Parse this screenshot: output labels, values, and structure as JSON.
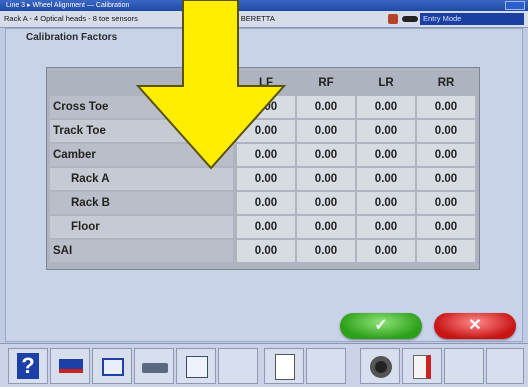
{
  "titlebar": {
    "title": "Line 3 ▸ Wheel Alignment — Calibration",
    "window_button": "close-icon"
  },
  "infobar": {
    "rack_text": "Rack A - 4 Optical heads - 8 toe sensors",
    "vehicle_text": "OLET, 1986, BERETTA",
    "mode_text": "Entry Mode"
  },
  "panel": {
    "title": "Calibration Factors"
  },
  "table": {
    "headers": [
      "LF",
      "RF",
      "LR",
      "RR"
    ],
    "rows": [
      {
        "label": "Cross Toe",
        "values": [
          "0.00",
          "0.00",
          "0.00",
          "0.00"
        ]
      },
      {
        "label": "Track Toe",
        "values": [
          "0.00",
          "0.00",
          "0.00",
          "0.00"
        ]
      },
      {
        "label": "Camber",
        "values": [
          "0.00",
          "0.00",
          "0.00",
          "0.00"
        ]
      },
      {
        "label": "Rack A",
        "values": [
          "0.00",
          "0.00",
          "0.00",
          "0.00"
        ]
      },
      {
        "label": "Rack B",
        "values": [
          "0.00",
          "0.00",
          "0.00",
          "0.00"
        ]
      },
      {
        "label": "Floor",
        "values": [
          "0.00",
          "0.00",
          "0.00",
          "0.00"
        ]
      },
      {
        "label": "SAI",
        "values": [
          "0.00",
          "0.00",
          "0.00",
          "0.00"
        ]
      }
    ]
  },
  "buttons": {
    "ok_glyph": "✓",
    "cancel_glyph": "✕"
  },
  "toolbar": {
    "icons": [
      "help-icon",
      "monitor-icon",
      "home-icon",
      "printer-icon",
      "edit-icon",
      "spacer",
      "document-icon",
      "spacer",
      "wheel-icon",
      "exit-icon"
    ]
  },
  "colors": {
    "ok": "#2ca018",
    "cancel": "#c81414",
    "arrow": "#ffee00",
    "mode_bar": "#1b3fa3"
  }
}
